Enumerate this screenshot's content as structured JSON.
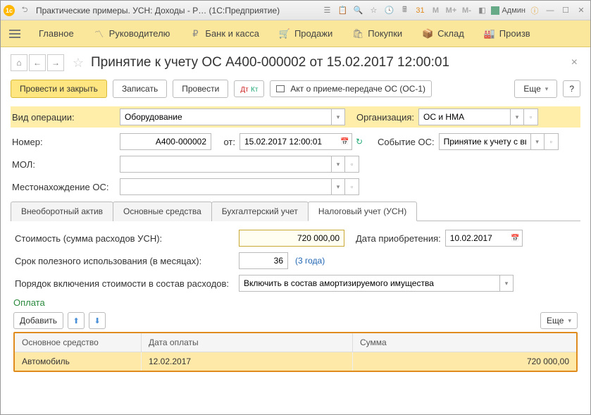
{
  "titlebar": {
    "app_title": "Практические примеры. УСН: Доходы - Р…  (1С:Предприятие)",
    "user": "Админ"
  },
  "nav": {
    "main": "Главное",
    "manager": "Руководителю",
    "bank": "Банк и касса",
    "sales": "Продажи",
    "purchases": "Покупки",
    "warehouse": "Склад",
    "production": "Произв"
  },
  "header": {
    "title": "Принятие к учету ОС А400-000002 от 15.02.2017 12:00:01"
  },
  "toolbar": {
    "post_close": "Провести и закрыть",
    "save": "Записать",
    "post": "Провести",
    "dk": "Дт Кт",
    "act": "Акт о приеме-передаче ОС (ОС-1)",
    "more": "Еще",
    "help": "?"
  },
  "form": {
    "op_type_label": "Вид операции:",
    "op_type_value": "Оборудование",
    "org_label": "Организация:",
    "org_value": "ОС и НМА",
    "number_label": "Номер:",
    "number_value": "А400-000002",
    "date_label": "от:",
    "date_value": "15.02.2017 12:00:01",
    "event_label": "Событие ОС:",
    "event_value": "Принятие к учету с вводом",
    "mol_label": "МОЛ:",
    "mol_value": "",
    "location_label": "Местонахождение ОС:",
    "location_value": ""
  },
  "tabs": {
    "t1": "Внеоборотный актив",
    "t2": "Основные средства",
    "t3": "Бухгалтерский учет",
    "t4": "Налоговый учет (УСН)"
  },
  "usn": {
    "cost_label": "Стоимость (сумма расходов УСН):",
    "cost_value": "720 000,00",
    "acq_date_label": "Дата приобретения:",
    "acq_date_value": "10.02.2017",
    "useful_life_label": "Срок полезного использования (в месяцах):",
    "useful_life_value": "36",
    "useful_life_hint": "(3 года)",
    "include_label": "Порядок включения стоимости в состав расходов:",
    "include_value": "Включить в состав амортизируемого имущества"
  },
  "payment": {
    "section": "Оплата",
    "add": "Добавить",
    "more": "Еще",
    "columns": {
      "asset": "Основное средство",
      "date": "Дата оплаты",
      "sum": "Сумма"
    },
    "rows": [
      {
        "asset": "Автомобиль",
        "date": "12.02.2017",
        "sum": "720 000,00"
      }
    ]
  }
}
